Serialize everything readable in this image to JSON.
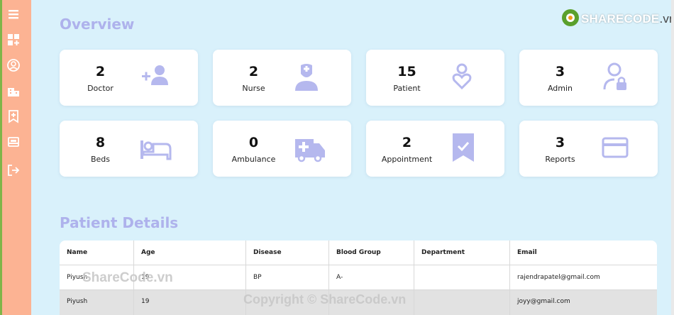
{
  "logo": {
    "brand": "SHARECODE",
    "tld": ".vn"
  },
  "sidebar": {
    "items": [
      {
        "icon": "menu-icon"
      },
      {
        "icon": "dashboard-add-icon"
      },
      {
        "icon": "user-circle-icon"
      },
      {
        "icon": "hospital-building-icon"
      },
      {
        "icon": "bookmark-add-icon"
      },
      {
        "icon": "bed-icon"
      },
      {
        "icon": "logout-icon"
      }
    ]
  },
  "overview": {
    "title": "Overview",
    "cards": [
      {
        "value": "2",
        "label": "Doctor",
        "icon": "add-user-icon"
      },
      {
        "value": "2",
        "label": "Nurse",
        "icon": "nurse-icon"
      },
      {
        "value": "15",
        "label": "Patient",
        "icon": "patient-heart-icon"
      },
      {
        "value": "3",
        "label": "Admin",
        "icon": "admin-lock-icon"
      },
      {
        "value": "8",
        "label": "Beds",
        "icon": "bed-icon"
      },
      {
        "value": "0",
        "label": "Ambulance",
        "icon": "ambulance-icon"
      },
      {
        "value": "2",
        "label": "Appointment",
        "icon": "bookmark-check-icon"
      },
      {
        "value": "3",
        "label": "Reports",
        "icon": "card-icon"
      }
    ]
  },
  "patients": {
    "title": "Patient Details",
    "columns": [
      "Name",
      "Age",
      "Disease",
      "Blood Group",
      "Department",
      "Email"
    ],
    "rows": [
      [
        "Piyush",
        "19",
        "BP",
        "A-",
        "",
        "rajendrapatel@gmail.com"
      ],
      [
        "Piyush",
        "19",
        "",
        "",
        "",
        "joyy@gmail.com"
      ]
    ]
  },
  "watermarks": {
    "primary": "ShareCode.vn",
    "secondary": "Copyright © ShareCode.vn"
  },
  "colors": {
    "background": "#d9f1fb",
    "sidebar": "#fcb393",
    "accent": "#aeb2ec",
    "icon": "#b5b8ee"
  }
}
